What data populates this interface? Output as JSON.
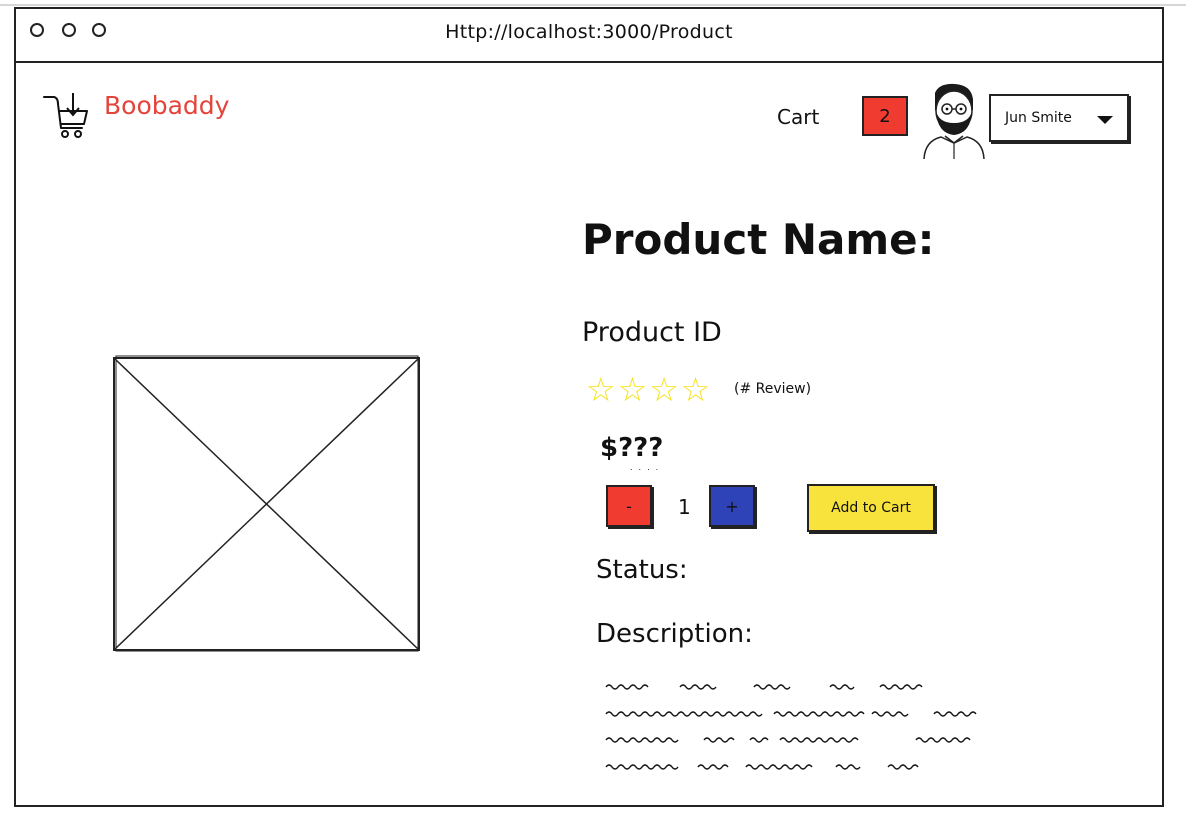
{
  "browser": {
    "url": "Http://localhost:3000/Product",
    "window_controls": [
      "close",
      "minimize",
      "maximize"
    ]
  },
  "header": {
    "brand": "Boobaddy",
    "logo_icon": "cart-download-icon",
    "cart_label": "Cart",
    "cart_count": "2",
    "avatar_icon": "bearded-man-avatar-icon",
    "user_name": "Jun Smite"
  },
  "product": {
    "image_placeholder": "image-placeholder-icon",
    "name_label": "Product Name:",
    "id_label": "Product ID",
    "rating": {
      "stars_total": 5,
      "stars_filled": 0,
      "reviews_label": "(# Review)"
    },
    "price": "$???",
    "quantity": {
      "minus_label": "-",
      "value": "1",
      "plus_label": "+"
    },
    "add_to_cart_label": "Add to Cart",
    "status_label": "Status:",
    "description_label": "Description:"
  },
  "colors": {
    "brand": "#e4443b",
    "cart_badge": "#ef3b30",
    "minus_button": "#ef3b30",
    "plus_button": "#2d43b7",
    "add_to_cart": "#f8e33c",
    "stars": "#f6e21c"
  }
}
